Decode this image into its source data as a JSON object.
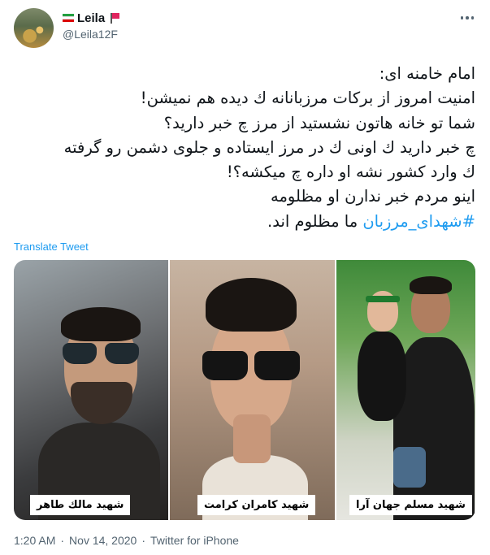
{
  "author": {
    "name": "Leila",
    "handle": "@Leila12F"
  },
  "icons": {
    "more": "more-options-icon",
    "flag_left": "iran-flag-icon",
    "flag_right": "red-flag-icon"
  },
  "tweet": {
    "lines": [
      "امام خامنه ای:",
      "امنیت امروز از برکات مرزبانانه ك دیده هم نمیشن!",
      "شما تو خانه هاتون نشستید از مرز چ خبر دارید؟",
      "چ خبر دارید ك اونی ك در مرز ایستاده و جلوی دشمن رو گرفته",
      "ك وارد کشور نشه او داره چ میکشه؟!",
      "اینو مردم خبر ندارن او مظلومه"
    ],
    "hashtag": "#شهدای_مرزبان",
    "last_line_rest": " ما مظلوم اند."
  },
  "translate_label": "Translate Tweet",
  "media": {
    "captions": [
      "شهید مالك طاهر",
      "شهید کامران کرامت",
      "شهید مسلم جهان آرا"
    ]
  },
  "meta": {
    "time": "1:20 AM",
    "date": "Nov 14, 2020",
    "separator": "·",
    "source": "Twitter for iPhone"
  },
  "colors": {
    "link": "#1d9bf0",
    "secondary_text": "#536471",
    "primary_text": "#0f1419"
  }
}
